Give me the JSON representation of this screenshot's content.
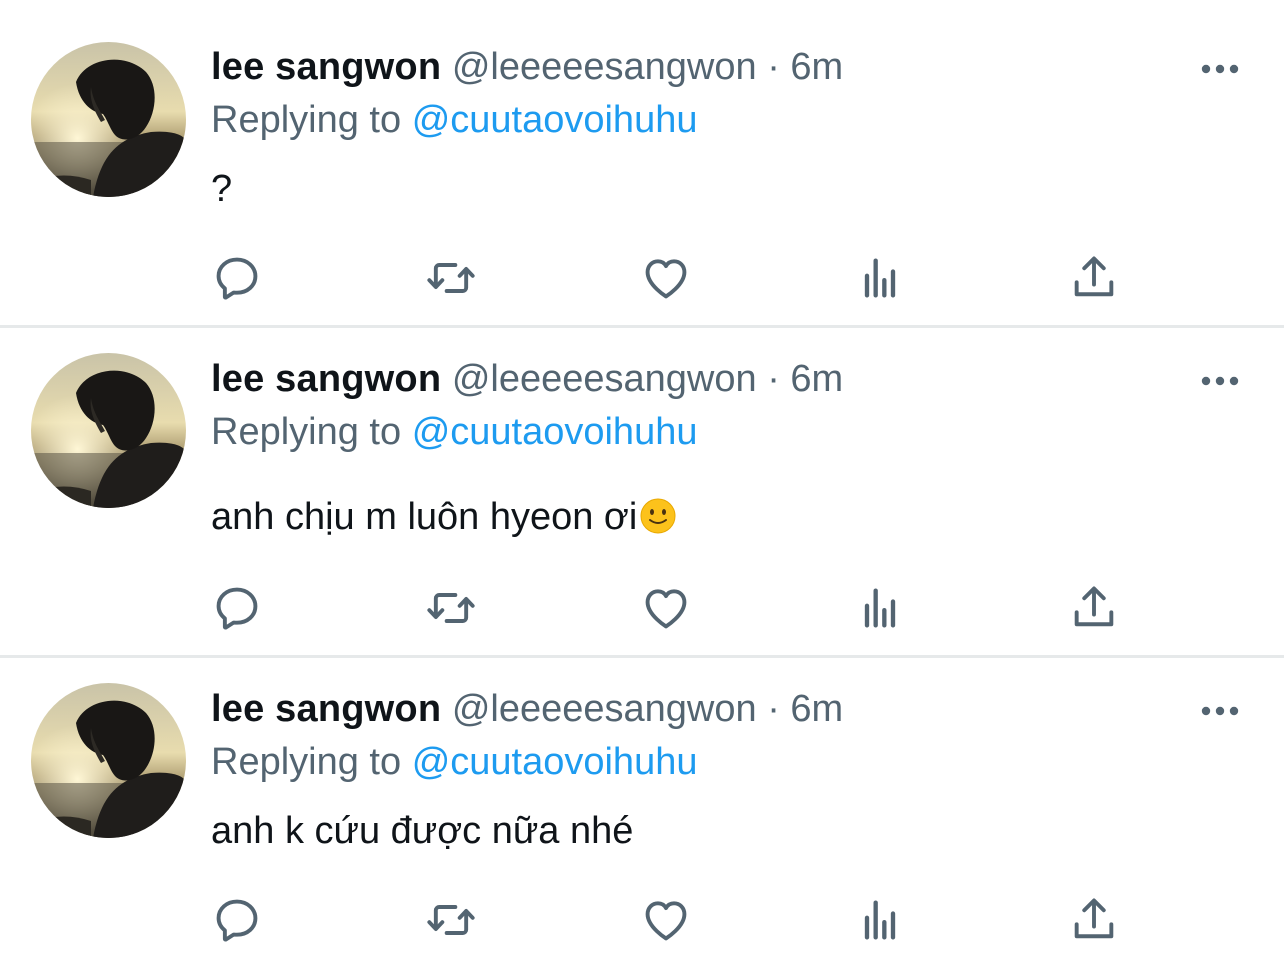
{
  "tweets": [
    {
      "name": "lee sangwon",
      "handle": "@leeeeesangwon",
      "separator": "·",
      "time": "6m",
      "replying_prefix": "Replying to",
      "replying_to": "@cuutaovoihuhu",
      "text": "?"
    },
    {
      "name": "lee sangwon",
      "handle": "@leeeeesangwon",
      "separator": "·",
      "time": "6m",
      "replying_prefix": "Replying to",
      "replying_to": "@cuutaovoihuhu",
      "text": "anh chịu m luôn hyeon ơi",
      "emoji": "slightly-smiling-face-emoji"
    },
    {
      "name": "lee sangwon",
      "handle": "@leeeeesangwon",
      "separator": "·",
      "time": "6m",
      "replying_prefix": "Replying to",
      "replying_to": "@cuutaovoihuhu",
      "text": "anh k cứu được nữa nhé"
    }
  ],
  "icons": {
    "reply": "reply-icon",
    "retweet": "retweet-icon",
    "like": "like-icon",
    "analytics": "analytics-icon",
    "share": "share-icon",
    "more": "more-icon"
  },
  "colors": {
    "text": "#0f1419",
    "secondary": "#536471",
    "link": "#1d9bf0",
    "divider": "#e6e9ea"
  }
}
